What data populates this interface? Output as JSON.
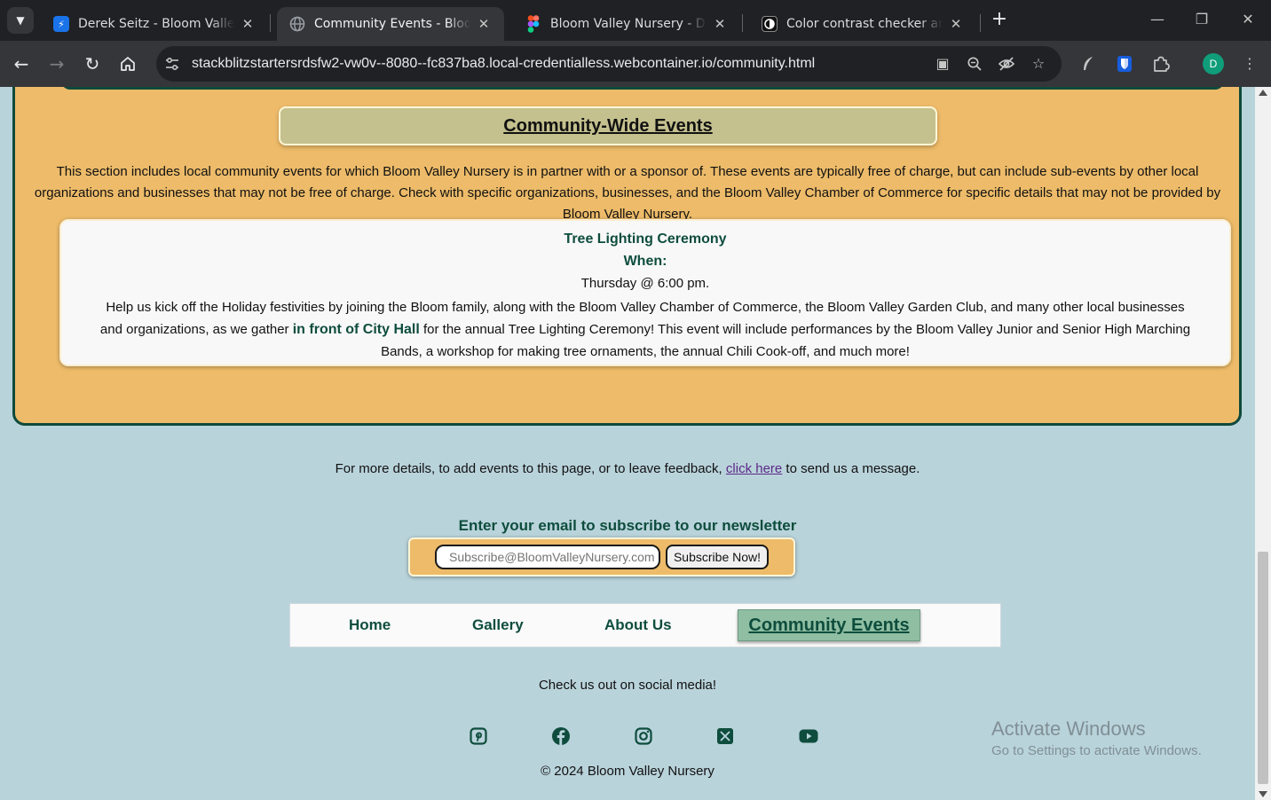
{
  "browser": {
    "tabs": [
      {
        "title": "Derek Seitz - Bloom Valley Nurs",
        "favicon": "bolt-icon",
        "favicon_color": "#1a73e8",
        "active": false
      },
      {
        "title": "Community Events - Bloom Valley",
        "favicon": "globe-icon",
        "favicon_color": "#9aa0a6",
        "active": true
      },
      {
        "title": "Bloom Valley Nursery - Desktop",
        "favicon": "figma-icon",
        "favicon_color": "#f24e1e",
        "active": false
      },
      {
        "title": "Color contrast checker analyzer",
        "favicon": "contrast-icon",
        "favicon_color": "#202124",
        "active": false
      }
    ],
    "url": "stackblitzstartersrdsfw2-vw0v--8080--fc837ba8.local-credentialless.webcontainer.io/community.html",
    "profile_initial": "D"
  },
  "page": {
    "section_title": "Community-Wide Events",
    "section_description": "This section includes local community events for which Bloom Valley Nursery is in partner with or a sponsor of. These events are typically free of charge, but can include sub-events by other local organizations and businesses that may not be free of charge. Check with specific organizations, businesses, and the Bloom Valley Chamber of Commerce for specific details that may not be provided by Bloom Valley Nursery.",
    "event": {
      "name": "Tree Lighting Ceremony",
      "when_label": "When:",
      "time": "Thursday @ 6:00 pm.",
      "body_before": "Help us kick off the Holiday festivities by joining the Bloom family, along with the Bloom Valley Chamber of Commerce, the Bloom Valley Garden Club, and many other local businesses and organizations, as we gather ",
      "location": "in front of City Hall",
      "body_after": " for the annual Tree Lighting Ceremony! This event will include performances by the Bloom Valley Junior and Senior High Marching Bands, a workshop for making tree ornaments, the annual Chili Cook-off, and much more!"
    },
    "more_details": {
      "before": "For more details, to add events to this page, or to leave feedback, ",
      "link": "click here",
      "after": " to send us a message."
    },
    "newsletter": {
      "title": "Enter your email to subscribe to our newsletter",
      "placeholder": "Subscribe@BloomValleyNursery.com",
      "button": "Subscribe Now!"
    },
    "nav": {
      "home": "Home",
      "gallery": "Gallery",
      "about": "About Us",
      "community": "Community Events"
    },
    "social_title": "Check us out on social media!",
    "social_icons": [
      "pinterest-icon",
      "facebook-icon",
      "instagram-icon",
      "x-icon",
      "youtube-icon"
    ],
    "copyright": "© 2024 Bloom Valley Nursery"
  },
  "watermark": {
    "line1": "Activate Windows",
    "line2": "Go to Settings to activate Windows."
  },
  "colors": {
    "page_bg": "#b9d3db",
    "panel_bg": "#edbb69",
    "panel_border": "#0f4a3c",
    "heading_green": "#0e4d3d",
    "title_bar": "#c5c18e",
    "active_nav": "#8fbea2",
    "link_purple": "#5b2a86"
  }
}
